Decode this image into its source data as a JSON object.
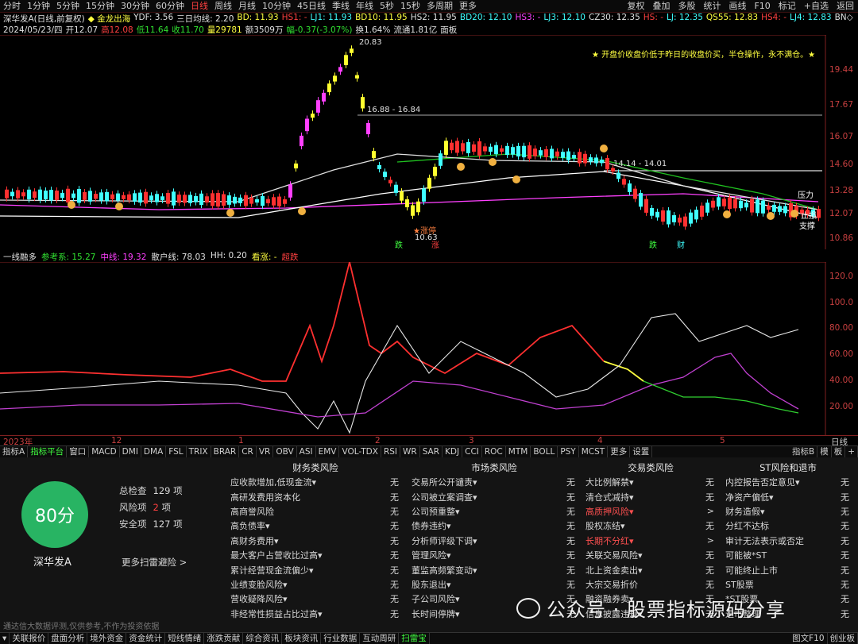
{
  "topbar": {
    "timeframes": [
      "分时",
      "1分钟",
      "5分钟",
      "15分钟",
      "30分钟",
      "60分钟",
      "日线",
      "周线",
      "月线",
      "10分钟",
      "45日线",
      "季线",
      "年线",
      "5秒",
      "15秒",
      "多周期",
      "更多"
    ],
    "active_timeframe": "日线",
    "tools": [
      "复权",
      "叠加",
      "多股",
      "统计",
      "画线",
      "F10",
      "标记",
      "+自选",
      "返回"
    ]
  },
  "info1": {
    "stock": "深华发A(日线,前复权)",
    "formula": "◆ 金龙出海",
    "ydf": "YDF: 3.56",
    "sanri": "三日均线: 2.20",
    "bd": "BD: 11.93",
    "hs1": "HS1: -",
    "lj1": "LJ1: 11.93",
    "bd10": "BD10: 11.95",
    "hs2": "HS2: 11.95",
    "bd20": "BD20: 12.10",
    "hs3": "HS3: -",
    "lj3": "LJ3: 12.10",
    "cz30": "CZ30: 12.35",
    "hs": "HS: -",
    "lj": "LJ: 12.35",
    "qs55": "QS55: 12.83",
    "hs4": "HS4: -",
    "lj4": "LJ4: 12.83",
    "bn": "BN◇"
  },
  "info2": {
    "date": "2024/05/23/四",
    "open": "开12.07",
    "high": "高12.08",
    "low": "低11.64",
    "close": "收11.70",
    "vol": "量29781",
    "amount": "额3509万",
    "change": "幅-0.37(-3.07%)",
    "turnover": "换1.64%",
    "float": "流通1.81亿",
    "panel": "面板"
  },
  "kline": {
    "annotation": "★ 开盘价收盘价低于昨日的收盘价买，半仓操作，永不满仓。★",
    "price_labels": {
      "p2083": "20.83",
      "p1688": "16.88 - 16.84",
      "p1401": "14.14 - 14.01",
      "p1063": "10.63"
    },
    "support_labels": [
      "压力",
      "止损",
      "支撑"
    ],
    "zt_label": "★涨停",
    "bottom_tags": [
      "跌",
      "涨",
      "跌",
      "财"
    ],
    "y_ticks": [
      "19.44",
      "17.67",
      "16.07",
      "14.60",
      "13.28",
      "12.07",
      "10.86"
    ]
  },
  "indicator": {
    "name": "一线融多",
    "ref": "参考系: 15.27",
    "mid": "中线: 19.32",
    "retail": "散户线: 78.03",
    "hh": "HH: 0.20",
    "label": "看涨: -",
    "over": "超跌",
    "y_ticks": [
      "120.0",
      "100.0",
      "80.00",
      "60.00",
      "40.00",
      "20.00"
    ]
  },
  "dateaxis": {
    "ticks": [
      "2023年",
      "12",
      "1",
      "2",
      "3",
      "4",
      "5"
    ],
    "right": "日线"
  },
  "tabs": {
    "items": [
      "指标A",
      "指标平台",
      "窗口",
      "MACD",
      "DMI",
      "DMA",
      "FSL",
      "TRIX",
      "BRAR",
      "CR",
      "VR",
      "OBV",
      "ASI",
      "EMV",
      "VOL-TDX",
      "RSI",
      "WR",
      "SAR",
      "KDJ",
      "CCI",
      "ROC",
      "MTM",
      "BOLL",
      "PSY",
      "MCST",
      "更多",
      "设置"
    ],
    "active": "指标平台",
    "right": [
      "指标B",
      "模",
      "板",
      "+"
    ]
  },
  "risk": {
    "score": "80分",
    "stock_name": "深华发A",
    "total_label": "总检查",
    "total_value": "129",
    "unit": "项",
    "risk_label": "风险项",
    "risk_value": "2",
    "safe_label": "安全项",
    "safe_value": "127",
    "more": "更多扫雷避险 >",
    "disclaimer": "通达信大数据评测,仅供参考,不作为投资依据",
    "watermark": "公众号 · 股票指标源码分享",
    "columns": [
      {
        "title": "财务类风险",
        "rows": [
          [
            "应收款增加,低现金流▾",
            "无"
          ],
          [
            "高研发费用资本化",
            "无"
          ],
          [
            "高商誉风险",
            "无"
          ],
          [
            "高负债率▾",
            "无"
          ],
          [
            "高财务费用▾",
            "无"
          ],
          [
            "最大客户占营收比过高▾",
            "无"
          ],
          [
            "累计经营现金流偏少▾",
            "无"
          ],
          [
            "业绩变脸风险▾",
            "无"
          ],
          [
            "营收疑降风险▾",
            "无"
          ],
          [
            "非经常性损益占比过高▾",
            "无"
          ]
        ]
      },
      {
        "title": "市场类风险",
        "rows": [
          [
            "交易所公开谴责▾",
            "无"
          ],
          [
            "公司被立案调查▾",
            "无"
          ],
          [
            "公司预重整▾",
            "无"
          ],
          [
            "债券违约▾",
            "无"
          ],
          [
            "分析师评级下调▾",
            "无"
          ],
          [
            "管理风险▾",
            "无"
          ],
          [
            "董监高频繁变动▾",
            "无"
          ],
          [
            "股东退出▾",
            "无"
          ],
          [
            "子公司风险▾",
            "无"
          ],
          [
            "长时间停牌▾",
            "无"
          ]
        ]
      },
      {
        "title": "交易类风险",
        "rows": [
          [
            "大比例解禁▾",
            "无"
          ],
          [
            "清仓式减持▾",
            "无"
          ],
          [
            "高质押风险▾",
            ">"
          ],
          [
            "股权冻结▾",
            "无"
          ],
          [
            "长期不分红▾",
            ">"
          ],
          [
            "关联交易风险▾",
            "无"
          ],
          [
            "北上资金卖出▾",
            "无"
          ],
          [
            "大宗交易折价",
            "无"
          ],
          [
            "融资融券卖▾",
            "无"
          ],
          [
            "信息披露违规▾",
            "无"
          ]
        ]
      },
      {
        "title": "ST风险和退市",
        "rows": [
          [
            "内控报告否定意见▾",
            "无"
          ],
          [
            "净资产偏低▾",
            "无"
          ],
          [
            "财务造假▾",
            "无"
          ],
          [
            "分红不达标",
            "无"
          ],
          [
            "审计无法表示或否定",
            "无"
          ],
          [
            "可能被*ST",
            "无"
          ],
          [
            "可能终止上市",
            "无"
          ],
          [
            "ST股票",
            "无"
          ],
          [
            "*ST股票",
            "无"
          ],
          [
            "退市整理",
            "无"
          ]
        ]
      }
    ]
  },
  "bottombar": {
    "items": [
      "关联报价",
      "盘面分析",
      "境外资金",
      "资金统计",
      "短线情绪",
      "涨跌贡献",
      "综合资讯",
      "板块资讯",
      "行业数据",
      "互动周研",
      "扫雷宝"
    ],
    "active": "扫雷宝",
    "right": [
      "图文F10",
      "创业板"
    ]
  }
}
